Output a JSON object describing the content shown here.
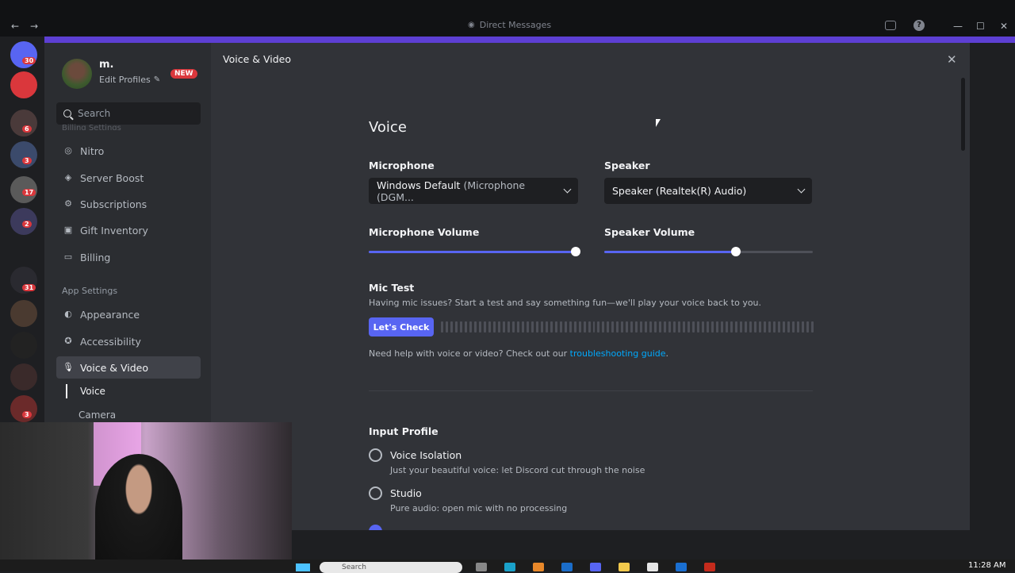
{
  "window": {
    "title": "Direct Messages"
  },
  "server_badges": [
    "30",
    "6",
    "3",
    "17",
    "2",
    "31",
    "3"
  ],
  "profile": {
    "name": "m.",
    "edit_label": "Edit Profiles",
    "badge": "NEW"
  },
  "search": {
    "placeholder": "Search"
  },
  "sidebar": {
    "faded_header": "Billing Settings",
    "billing_items": [
      {
        "label": "Nitro",
        "icon": "nitro-icon"
      },
      {
        "label": "Server Boost",
        "icon": "boost-icon"
      },
      {
        "label": "Subscriptions",
        "icon": "subscriptions-icon"
      },
      {
        "label": "Gift Inventory",
        "icon": "gift-icon"
      },
      {
        "label": "Billing",
        "icon": "card-icon"
      }
    ],
    "app_settings_header": "App Settings",
    "app_items": [
      {
        "label": "Appearance",
        "icon": "palette-icon"
      },
      {
        "label": "Accessibility",
        "icon": "accessibility-icon"
      },
      {
        "label": "Voice & Video",
        "icon": "microphone-icon",
        "active": true
      }
    ],
    "sub_items": [
      {
        "label": "Voice",
        "active": true
      },
      {
        "label": "Camera"
      }
    ]
  },
  "content": {
    "page_title": "Voice & Video",
    "voice_heading": "Voice",
    "microphone": {
      "label": "Microphone",
      "value_main": "Windows Default",
      "value_dim": "(Microphone (DGM..."
    },
    "speaker": {
      "label": "Speaker",
      "value": "Speaker (Realtek(R) Audio)"
    },
    "mic_volume": {
      "label": "Microphone Volume",
      "level": 0.98
    },
    "speaker_volume": {
      "label": "Speaker Volume",
      "level": 0.63
    },
    "mic_test": {
      "label": "Mic Test",
      "description": "Having mic issues? Start a test and say something fun—we'll play your voice back to you.",
      "button": "Let's Check"
    },
    "help": {
      "text": "Need help with voice or video? Check out our ",
      "link": "troubleshooting guide",
      "suffix": "."
    },
    "input_profile": {
      "label": "Input Profile",
      "options": [
        {
          "title": "Voice Isolation",
          "desc": "Just your beautiful voice: let Discord cut through the noise",
          "selected": false
        },
        {
          "title": "Studio",
          "desc": "Pure audio: open mic with no processing",
          "selected": false
        }
      ]
    }
  },
  "taskbar": {
    "search_placeholder": "Search",
    "clock": "11:28 AM"
  },
  "colors": {
    "accent": "#5865f2",
    "link": "#00a8fc",
    "danger": "#da373c",
    "banner": "#5d3fd3"
  }
}
